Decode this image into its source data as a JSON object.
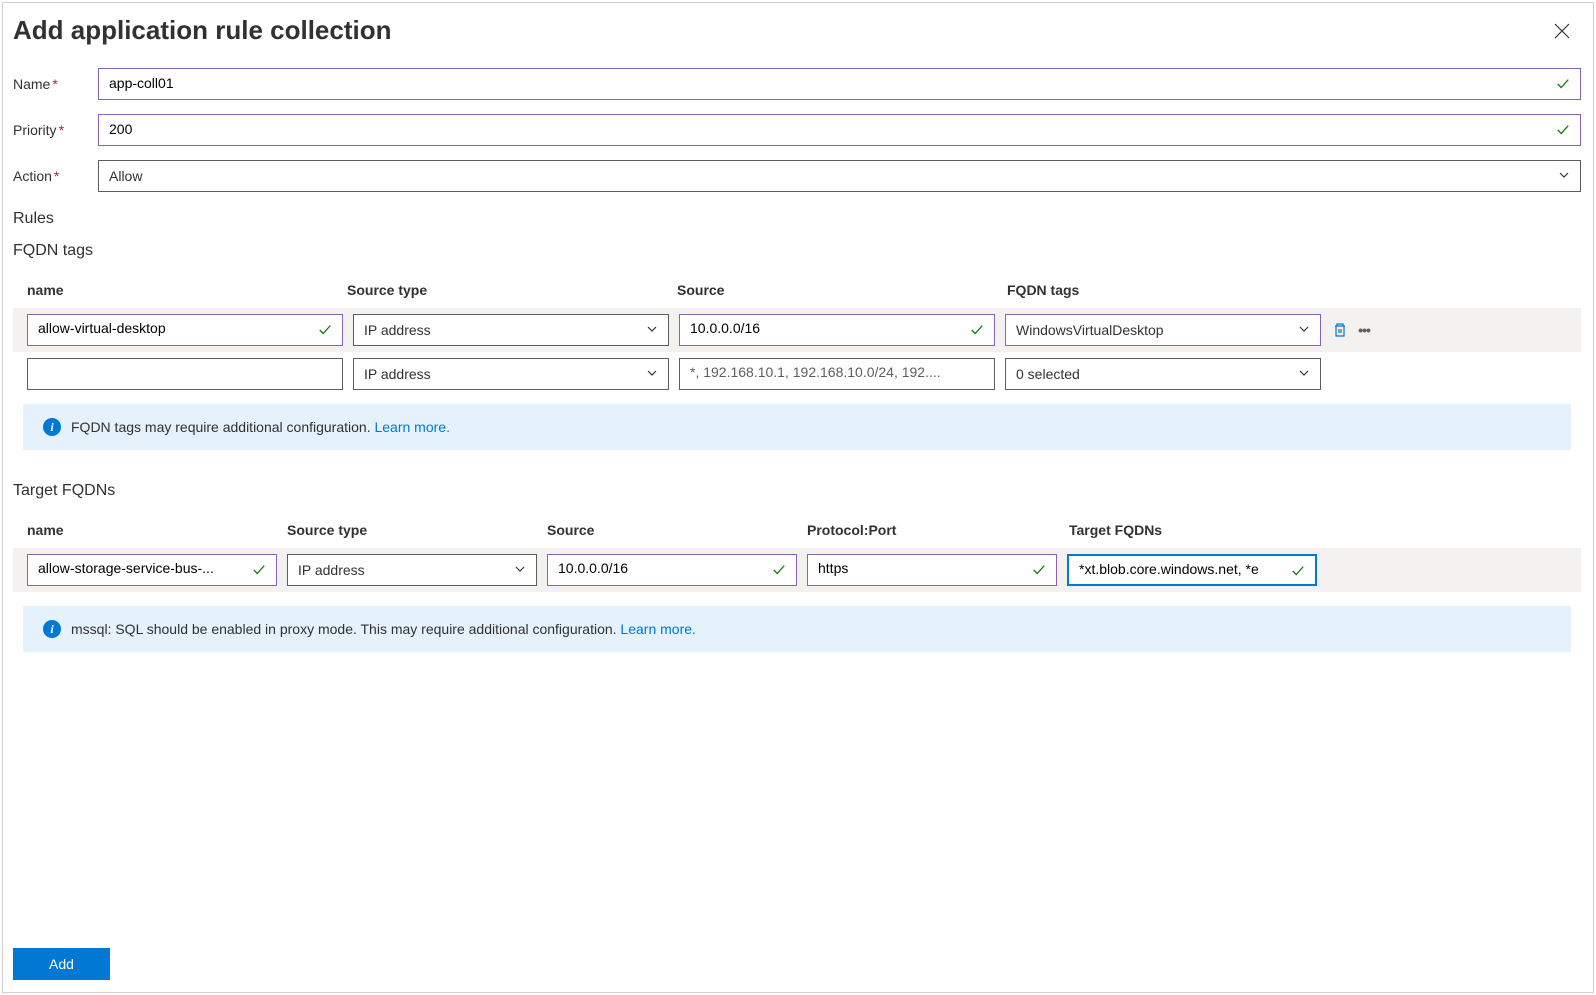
{
  "header": {
    "title": "Add application rule collection"
  },
  "form": {
    "name_label": "Name",
    "name_value": "app-coll01",
    "priority_label": "Priority",
    "priority_value": "200",
    "action_label": "Action",
    "action_value": "Allow"
  },
  "sections": {
    "rules": "Rules",
    "fqdn_tags": "FQDN tags",
    "target_fqdns": "Target FQDNs"
  },
  "fqdn_table": {
    "headers": {
      "name": "name",
      "source_type": "Source type",
      "source": "Source",
      "fqdn_tags": "FQDN tags"
    },
    "rows": [
      {
        "name": "allow-virtual-desktop",
        "source_type": "IP address",
        "source": "10.0.0.0/16",
        "fqdn_tags": "WindowsVirtualDesktop"
      },
      {
        "name": "",
        "source_type": "IP address",
        "source_placeholder": "*, 192.168.10.1, 192.168.10.0/24, 192....",
        "fqdn_tags": "0 selected"
      }
    ]
  },
  "target_table": {
    "headers": {
      "name": "name",
      "source_type": "Source type",
      "source": "Source",
      "protocol": "Protocol:Port",
      "target_fqdns": "Target FQDNs"
    },
    "rows": [
      {
        "name": "allow-storage-service-bus-...",
        "source_type": "IP address",
        "source": "10.0.0.0/16",
        "protocol": "https",
        "target_fqdns": "*xt.blob.core.windows.net, *e"
      }
    ]
  },
  "banners": {
    "fqdn_info": "FQDN tags may require additional configuration. ",
    "mssql_info": "mssql: SQL should be enabled in proxy mode. This may require additional configuration. ",
    "learn_more": "Learn more."
  },
  "footer": {
    "add_button": "Add"
  }
}
